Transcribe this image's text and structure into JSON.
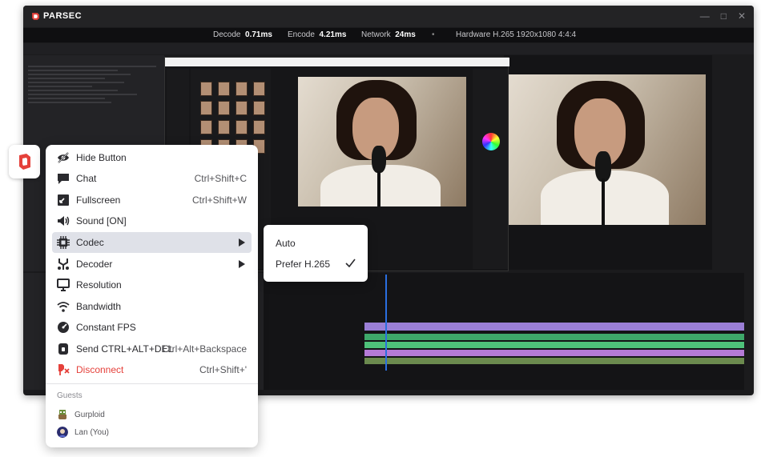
{
  "app": {
    "brand": "PARSEC"
  },
  "stats": {
    "decode_label": "Decode",
    "decode_value": "0.71ms",
    "encode_label": "Encode",
    "encode_value": "4.21ms",
    "network_label": "Network",
    "network_value": "24ms",
    "hardware_text": "Hardware H.265 1920x1080 4:4:4"
  },
  "menu": {
    "items": [
      {
        "label": "Hide Button",
        "shortcut": "",
        "icon": "hide-eye-icon"
      },
      {
        "label": "Chat",
        "shortcut": "Ctrl+Shift+C",
        "icon": "chat-bubble-icon"
      },
      {
        "label": "Fullscreen",
        "shortcut": "Ctrl+Shift+W",
        "icon": "fullscreen-icon"
      },
      {
        "label": "Sound [ON]",
        "shortcut": "",
        "icon": "speaker-icon"
      },
      {
        "label": "Codec",
        "shortcut": "",
        "icon": "chip-icon"
      },
      {
        "label": "Decoder",
        "shortcut": "",
        "icon": "decoder-icon"
      },
      {
        "label": "Resolution",
        "shortcut": "",
        "icon": "monitor-icon"
      },
      {
        "label": "Bandwidth",
        "shortcut": "",
        "icon": "wifi-icon"
      },
      {
        "label": "Constant FPS",
        "shortcut": "",
        "icon": "gauge-icon"
      },
      {
        "label": "Send CTRL+ALT+DEL",
        "shortcut": "Ctrl+Alt+Backspace",
        "icon": "lock-icon"
      },
      {
        "label": "Disconnect",
        "shortcut": "Ctrl+Shift+'",
        "icon": "disconnect-icon"
      }
    ],
    "guests_heading": "Guests",
    "guests": [
      {
        "name": "Gurploid"
      },
      {
        "name": "Lan (You)"
      }
    ]
  },
  "codec_submenu": {
    "options": [
      "Auto",
      "Prefer H.265"
    ],
    "selected": "Prefer H.265"
  },
  "colors": {
    "disconnect_red": "#e5413b",
    "brand_red": "#e5413b",
    "highlight": "#dfe1e8",
    "timeline_purple": "#9b7fd6",
    "timeline_green": "#4ec27a"
  }
}
